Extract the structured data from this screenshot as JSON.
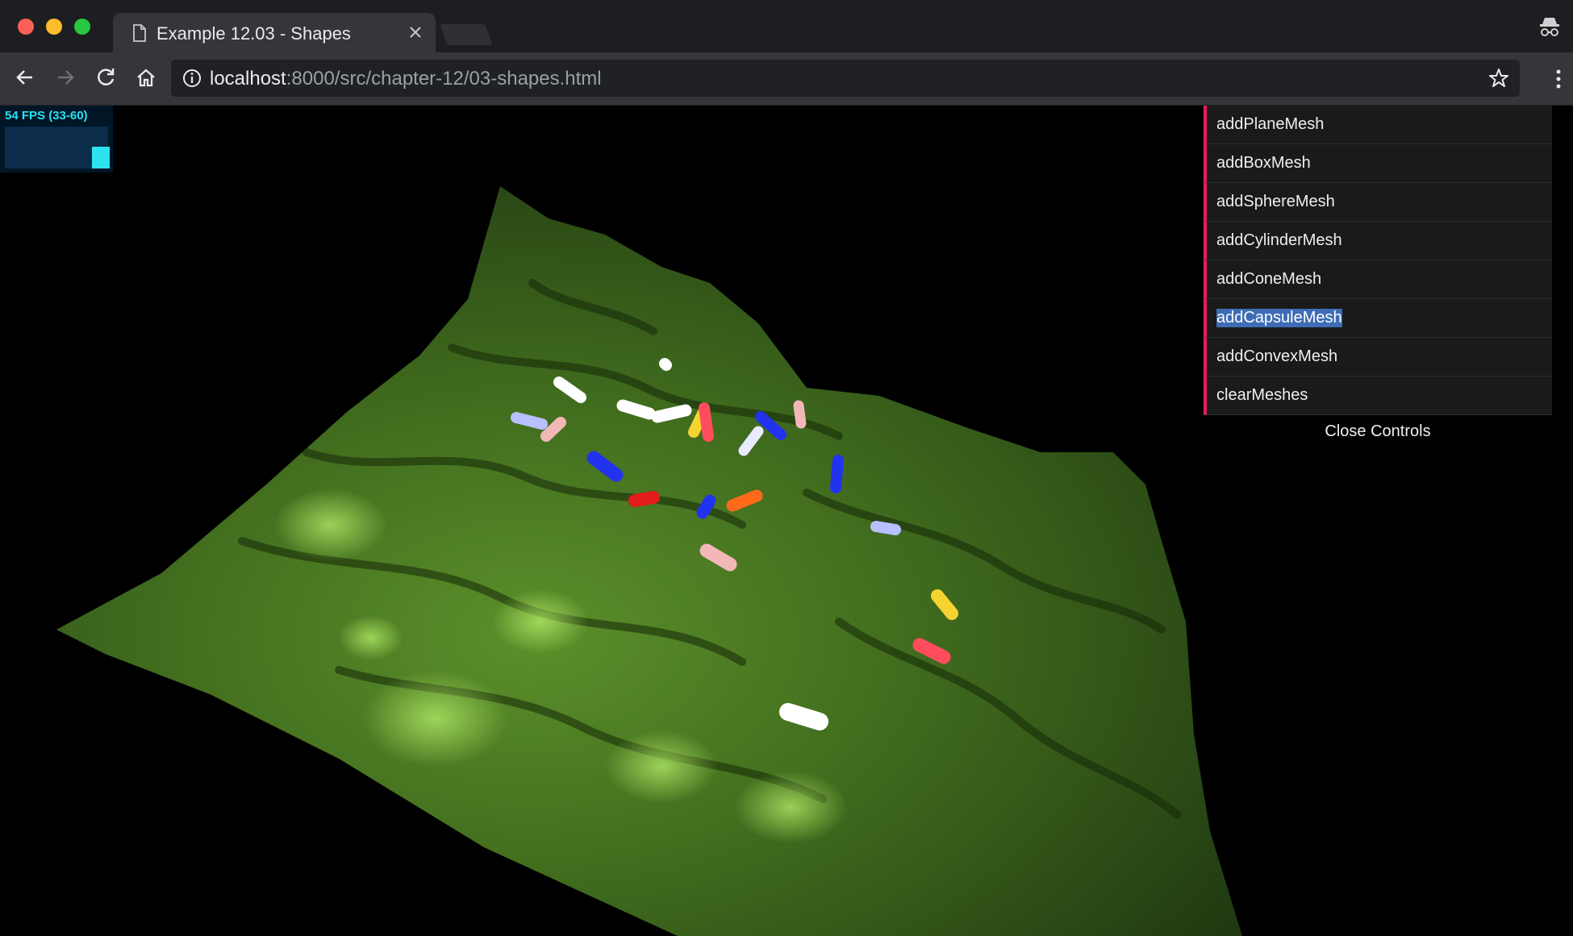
{
  "browser": {
    "tab_title": "Example 12.03 - Shapes",
    "url_host": "localhost",
    "url_rest": ":8000/src/chapter-12/03-shapes.html"
  },
  "stats": {
    "fps_text": "54 FPS (33-60)",
    "fps": 54,
    "fps_min": 33,
    "fps_max": 60,
    "color": "#2ce2ee"
  },
  "gui": {
    "accent_color": "#e61d5f",
    "items": [
      {
        "label": "addPlaneMesh"
      },
      {
        "label": "addBoxMesh"
      },
      {
        "label": "addSphereMesh"
      },
      {
        "label": "addCylinderMesh"
      },
      {
        "label": "addConeMesh"
      },
      {
        "label": "addCapsuleMesh",
        "selected": true
      },
      {
        "label": "addConvexMesh"
      },
      {
        "label": "clearMeshes"
      }
    ],
    "close_label": "Close Controls"
  },
  "scene": {
    "terrain_color": "#3f6a1d",
    "capsule_colors": [
      "#f5d432",
      "#ffffff",
      "#b8c0ff",
      "#f2b8b8",
      "#ff4d5d",
      "#2233ee",
      "#ff6a1a",
      "#e31b1b"
    ]
  }
}
